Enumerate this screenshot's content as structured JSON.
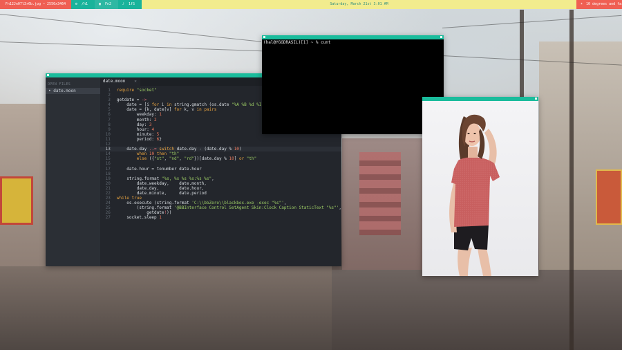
{
  "topbar": {
    "file_label": "Fn12Jn07l3r6b.jpg — 2550x3464",
    "workspaces": [
      {
        "icon": "⚙",
        "label": "/h1"
      },
      {
        "icon": "▣",
        "label": "Fn2"
      },
      {
        "icon": "♪",
        "label": "1fS"
      }
    ],
    "clock": "Saturday, March 21st 3:01 AM",
    "weather_icon": "☀",
    "weather": "10 degrees and fair"
  },
  "editor": {
    "sidebar_title": "OPEN FILES",
    "open_files": [
      "date.moon"
    ],
    "tab_label": "date.moon",
    "current_line": 13,
    "lines": [
      "require \"socket\"",
      "",
      "getdate = ->",
      "    date = [i for i in string.gmatch (os.date \"%A %B %d %I %M %p\"), \"%S+\"]",
      "    date = {k, date[v] for k, v in pairs",
      "        weekday: 1",
      "        month: 2",
      "        day: 3",
      "        hour: 4",
      "        minute: 5",
      "        period: 6}",
      "",
      "    date.day ..= switch date.day - (date.day % 10)",
      "        when 10 then \"th\"",
      "        else ({\"st\", \"nd\", \"rd\"})[date.day % 10] or \"th\"",
      "",
      "    date.hour = tonumber date.hour",
      "",
      "    string.format \"%s, %s %s %s:%s %s\",",
      "        date.weekday,    date.month,",
      "        date.day,        date.hour,",
      "        date.minute,     date.period",
      "while true",
      "    os.execute (string.format 'C:\\\\bbZero\\\\blackbox.exe -exec \"%s\"',",
      "        (string.format '@BBInterface Control SetAgent Skin:Clock Caption StaticText \"%s\"',",
      "            getdate!))",
      "    socket.sleep 1"
    ]
  },
  "terminal": {
    "prompt_line": "(hal@YGGDRASIL)[1] ~ % cunt"
  },
  "photo": {
    "subject": "woman-in-red-tshirt"
  },
  "colors": {
    "accent": "#1abc9c",
    "topbar_bg": "#f2ec8e",
    "topbar_red": "#ef5f53",
    "editor_bg": "#23262c",
    "keyword": "#e8a33f",
    "string": "#9ccc65",
    "number": "#f07c5f",
    "operator": "#e06c75"
  }
}
